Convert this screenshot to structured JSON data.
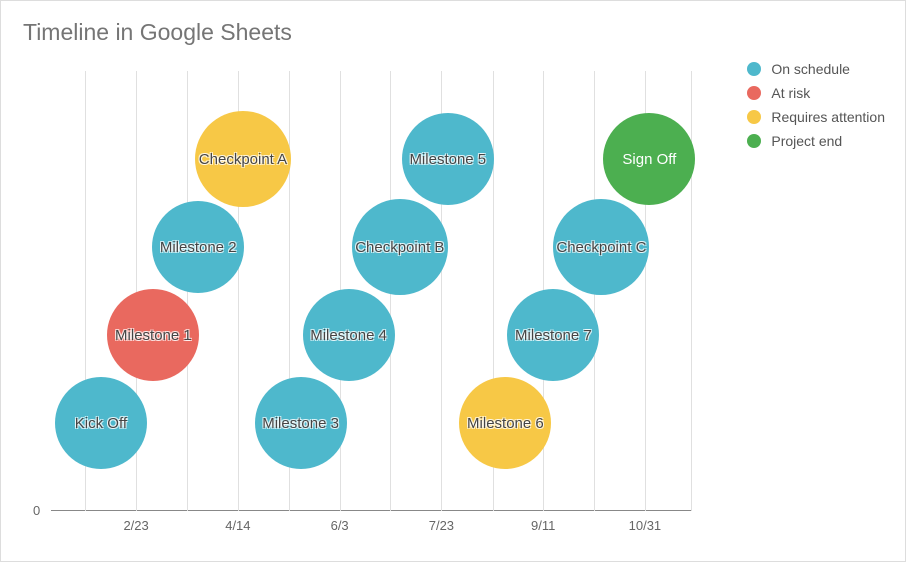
{
  "chart_data": {
    "type": "scatter",
    "title": "Timeline in Google Sheets",
    "xlabel": "",
    "ylabel": "",
    "ylim": [
      0,
      5
    ],
    "x_ticks": [
      "2/23",
      "4/14",
      "6/3",
      "7/23",
      "9/11",
      "10/31"
    ],
    "x_tick_positions": [
      0.133,
      0.292,
      0.451,
      0.61,
      0.769,
      0.928
    ],
    "gridline_positions": [
      0.053,
      0.133,
      0.212,
      0.292,
      0.372,
      0.451,
      0.53,
      0.61,
      0.69,
      0.769,
      0.848,
      0.928,
      1.0
    ],
    "legend": [
      {
        "label": "On schedule",
        "color": "#4EB8CC"
      },
      {
        "label": "At risk",
        "color": "#E9695F"
      },
      {
        "label": "Requires attention",
        "color": "#F7C846"
      },
      {
        "label": "Project end",
        "color": "#4CAF50"
      }
    ],
    "y_axis_zero": "0",
    "points": [
      {
        "label": "Kick Off",
        "x": 0.078,
        "y": 1,
        "size": 92,
        "status": "On schedule",
        "color": "#4EB8CC"
      },
      {
        "label": "Milestone 1",
        "x": 0.16,
        "y": 2,
        "size": 92,
        "status": "At risk",
        "color": "#E9695F"
      },
      {
        "label": "Milestone 2",
        "x": 0.23,
        "y": 3,
        "size": 92,
        "status": "On schedule",
        "color": "#4EB8CC"
      },
      {
        "label": "Checkpoint A",
        "x": 0.3,
        "y": 4,
        "size": 96,
        "status": "Requires attention",
        "color": "#F7C846"
      },
      {
        "label": "Milestone 3",
        "x": 0.39,
        "y": 1,
        "size": 92,
        "status": "On schedule",
        "color": "#4EB8CC"
      },
      {
        "label": "Milestone 4",
        "x": 0.465,
        "y": 2,
        "size": 92,
        "status": "On schedule",
        "color": "#4EB8CC"
      },
      {
        "label": "Checkpoint B",
        "x": 0.545,
        "y": 3,
        "size": 96,
        "status": "On schedule",
        "color": "#4EB8CC"
      },
      {
        "label": "Milestone 5",
        "x": 0.62,
        "y": 4,
        "size": 92,
        "status": "On schedule",
        "color": "#4EB8CC"
      },
      {
        "label": "Milestone 6",
        "x": 0.71,
        "y": 1,
        "size": 92,
        "status": "Requires attention",
        "color": "#F7C846"
      },
      {
        "label": "Milestone 7",
        "x": 0.785,
        "y": 2,
        "size": 92,
        "status": "On schedule",
        "color": "#4EB8CC"
      },
      {
        "label": "Checkpoint C",
        "x": 0.86,
        "y": 3,
        "size": 96,
        "status": "On schedule",
        "color": "#4EB8CC"
      },
      {
        "label": "Sign Off",
        "x": 0.935,
        "y": 4,
        "size": 92,
        "status": "Project end",
        "color": "#4CAF50"
      }
    ]
  }
}
